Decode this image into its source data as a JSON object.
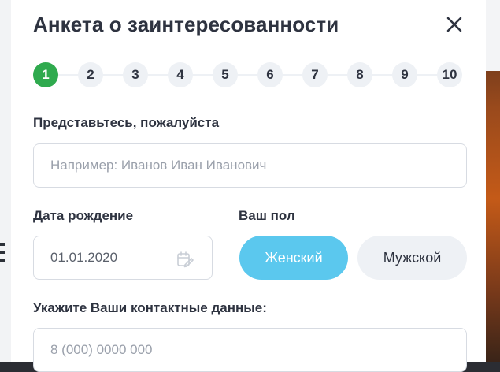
{
  "modal": {
    "title": "Анкета о заинтересованности",
    "close_label": "×"
  },
  "stepper": {
    "active": 1,
    "steps": [
      "1",
      "2",
      "3",
      "4",
      "5",
      "6",
      "7",
      "8",
      "9",
      "10"
    ]
  },
  "form": {
    "name": {
      "label": "Представьтесь, пожалуйста",
      "placeholder": "Например: Иванов Иван Иванович"
    },
    "birthdate": {
      "label": "Дата рождение",
      "value": "01.01.2020",
      "icon": "calendar-edit-icon"
    },
    "gender": {
      "label": "Ваш пол",
      "options": [
        "Женский",
        "Мужской"
      ],
      "selected": "Женский"
    },
    "contacts": {
      "label": "Укажите Ваши контактные данные:",
      "placeholder": "8 (000) 0000 000"
    }
  },
  "colors": {
    "active_step": "#2faa4e",
    "selected_pill": "#5bc8ee",
    "text": "#2e3340"
  }
}
